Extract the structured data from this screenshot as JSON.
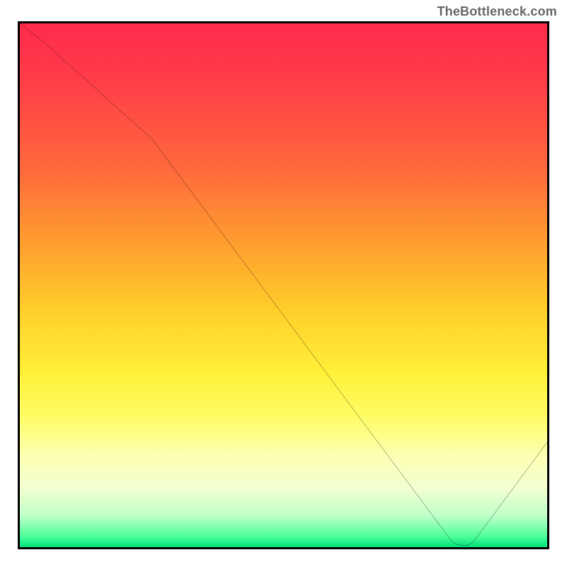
{
  "attribution": "TheBottleneck.com",
  "marker_label": "",
  "gradient_colors": {
    "top": "#ff2b4c",
    "mid_upper": "#ff9e2f",
    "mid": "#fff13a",
    "mid_lower": "#fcffb6",
    "bottom": "#00e27a"
  },
  "chart_data": {
    "type": "line",
    "title": "",
    "xlabel": "",
    "ylabel": "",
    "xlim": [
      0,
      100
    ],
    "ylim": [
      0,
      100
    ],
    "x": [
      0,
      5,
      25,
      82,
      83,
      84,
      85,
      86,
      100
    ],
    "values": [
      100,
      96,
      78,
      1,
      0.5,
      0.3,
      0.4,
      1,
      20
    ],
    "annotations": [
      {
        "x": 84,
        "y": 1.5,
        "text": ""
      }
    ],
    "notes": "V-shaped bottleneck curve. Steepens after x≈25, reaches minimum near x≈84, then rises toward bottom-right. Background is heat gradient top(red)→bottom(green)."
  }
}
